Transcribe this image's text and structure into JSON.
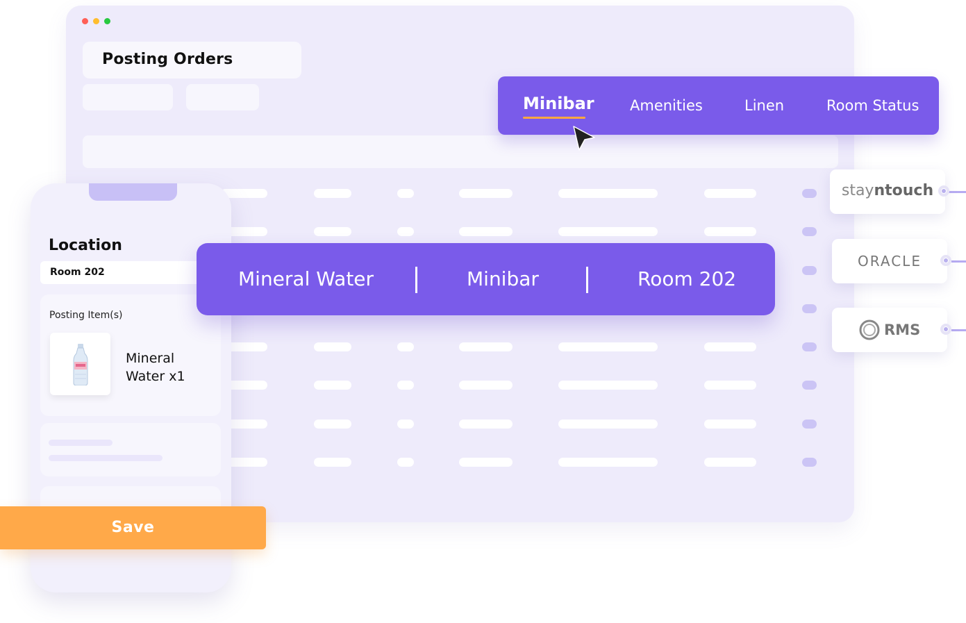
{
  "window": {
    "title": "Posting Orders",
    "controls": [
      {
        "name": "close",
        "color": "#ff5f57"
      },
      {
        "name": "minimize",
        "color": "#ffbd2e"
      },
      {
        "name": "maximize",
        "color": "#28c940"
      }
    ]
  },
  "tabs": {
    "items": [
      {
        "label": "Minibar",
        "active": true
      },
      {
        "label": "Amenities",
        "active": false
      },
      {
        "label": "Linen",
        "active": false
      },
      {
        "label": "Room Status",
        "active": false
      }
    ]
  },
  "integrations": [
    {
      "name": "stayntouch",
      "prefix": "stay",
      "emphasis": "ntouch"
    },
    {
      "name": "ORACLE"
    },
    {
      "name": "RMS"
    }
  ],
  "mobile": {
    "location_label": "Location",
    "location_value": "Room 202",
    "posting_label": "Posting Item(s)",
    "item_name": "Mineral Water x1",
    "item_icon": "water-bottle-icon",
    "save_label": "Save"
  },
  "summary": {
    "item": "Mineral Water",
    "category": "Minibar",
    "room": "Room 202"
  },
  "colors": {
    "accent": "#7a5bea",
    "window_bg": "#eeebfb",
    "save": "#ffa949",
    "underline": "#ffa740"
  }
}
